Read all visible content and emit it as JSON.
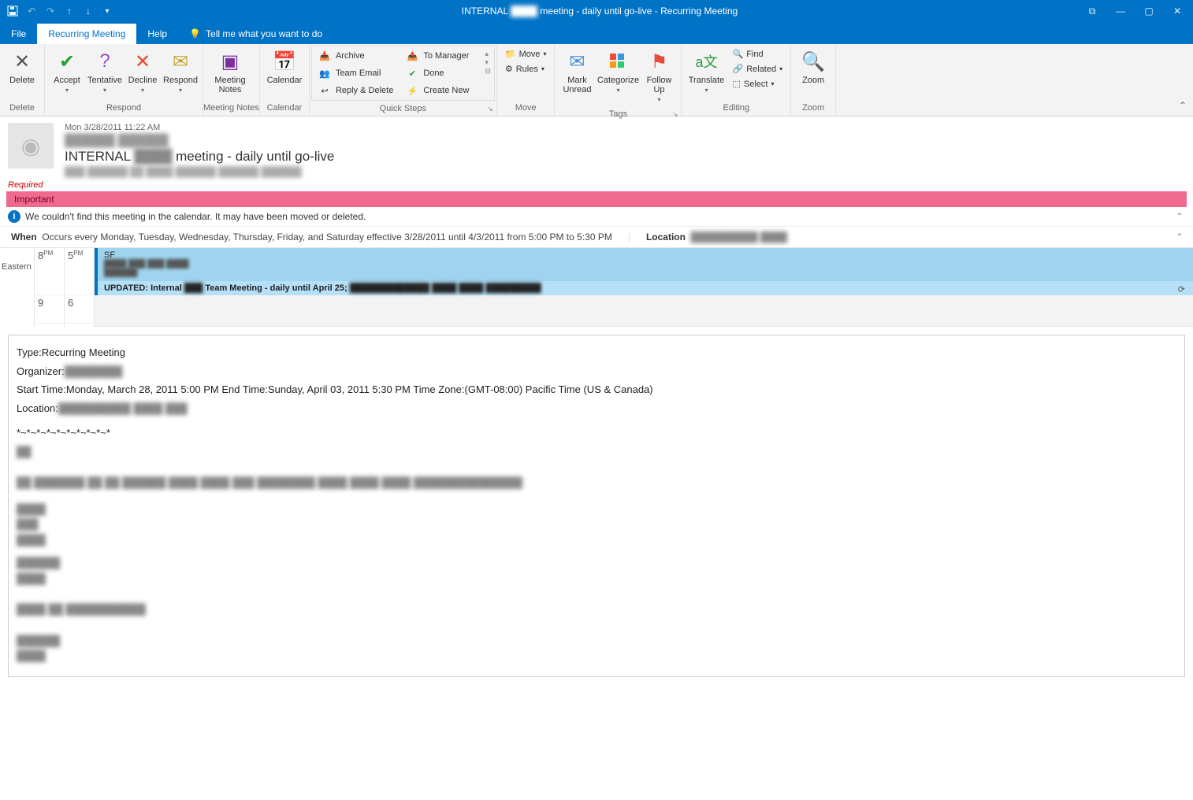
{
  "titlebar": {
    "title_prefix": "INTERNAL",
    "title_mid": "meeting - daily until go-live  -  Recurring Meeting"
  },
  "menu": {
    "file": "File",
    "recurring": "Recurring Meeting",
    "help": "Help",
    "tellme": "Tell me what you want to do"
  },
  "ribbon": {
    "delete": "Delete",
    "delete_group": "Delete",
    "accept": "Accept",
    "tentative": "Tentative",
    "decline": "Decline",
    "respond": "Respond",
    "respond_group": "Respond",
    "meeting_notes": "Meeting Notes",
    "notes_group": "Meeting Notes",
    "calendar": "Calendar",
    "calendar_group": "Calendar",
    "qs": {
      "archive": "Archive",
      "team_email": "Team Email",
      "reply_delete": "Reply & Delete",
      "to_manager": "To Manager",
      "done": "Done",
      "create_new": "Create New"
    },
    "qs_group": "Quick Steps",
    "move": "Move",
    "rules": "Rules",
    "move_group": "Move",
    "mark_unread": "Mark Unread",
    "categorize": "Categorize",
    "follow_up": "Follow Up",
    "tags_group": "Tags",
    "translate": "Translate",
    "find": "Find",
    "related": "Related",
    "select": "Select",
    "editing_group": "Editing",
    "zoom": "Zoom",
    "zoom_group": "Zoom"
  },
  "header": {
    "date": "Mon 3/28/2011 11:22 AM",
    "from_redacted": "██████  ██████",
    "subject_prefix": "INTERNAL",
    "subject_suffix": "meeting - daily until go-live",
    "to_redacted": "███ ██████ ██ ████ ██████ ██████ ██████",
    "required": "Required"
  },
  "bars": {
    "important": "Important",
    "info": "We couldn't find this meeting in the calendar. It may have been moved or deleted."
  },
  "when": {
    "label": "When",
    "text": "Occurs every Monday, Tuesday, Wednesday, Thursday, Friday, and Saturday effective 3/28/2011 until 4/3/2011 from 5:00 PM to 5:30 PM",
    "location_label": "Location",
    "location_redacted": "██████████ ████"
  },
  "calendar": {
    "tz": "Eastern",
    "left_times": [
      "8",
      "9"
    ],
    "left_suffix": "PM",
    "right_times": [
      "5",
      "6"
    ],
    "right_suffix": "PM",
    "event1_title": "SF",
    "event1_sub": "████ ███ ███ ████",
    "event1_sub2": "██████",
    "event2_prefix": "UPDATED: Internal",
    "event2_suffix": "Team Meeting - daily until April 25;",
    "event2_redacted": "█████████████ ████ ████ █████████"
  },
  "body": {
    "type_label": "Type:",
    "type_value": "Recurring Meeting",
    "organizer_label": "Organizer:",
    "organizer_redacted": "████████",
    "start_label": "Start Time:",
    "start_value": "Monday, March 28, 2011 5:00 PM",
    "end_label": "End Time:",
    "end_value": "Sunday, April 03, 2011 5:30 PM",
    "tz_label": "Time Zone:",
    "tz_value": "(GMT-08:00) Pacific Time (US & Canada)",
    "loc_label": "Location:",
    "loc_redacted": "██████████ ████ ███",
    "separator": "*~*~*~*~*~*~*~*~*~*"
  }
}
